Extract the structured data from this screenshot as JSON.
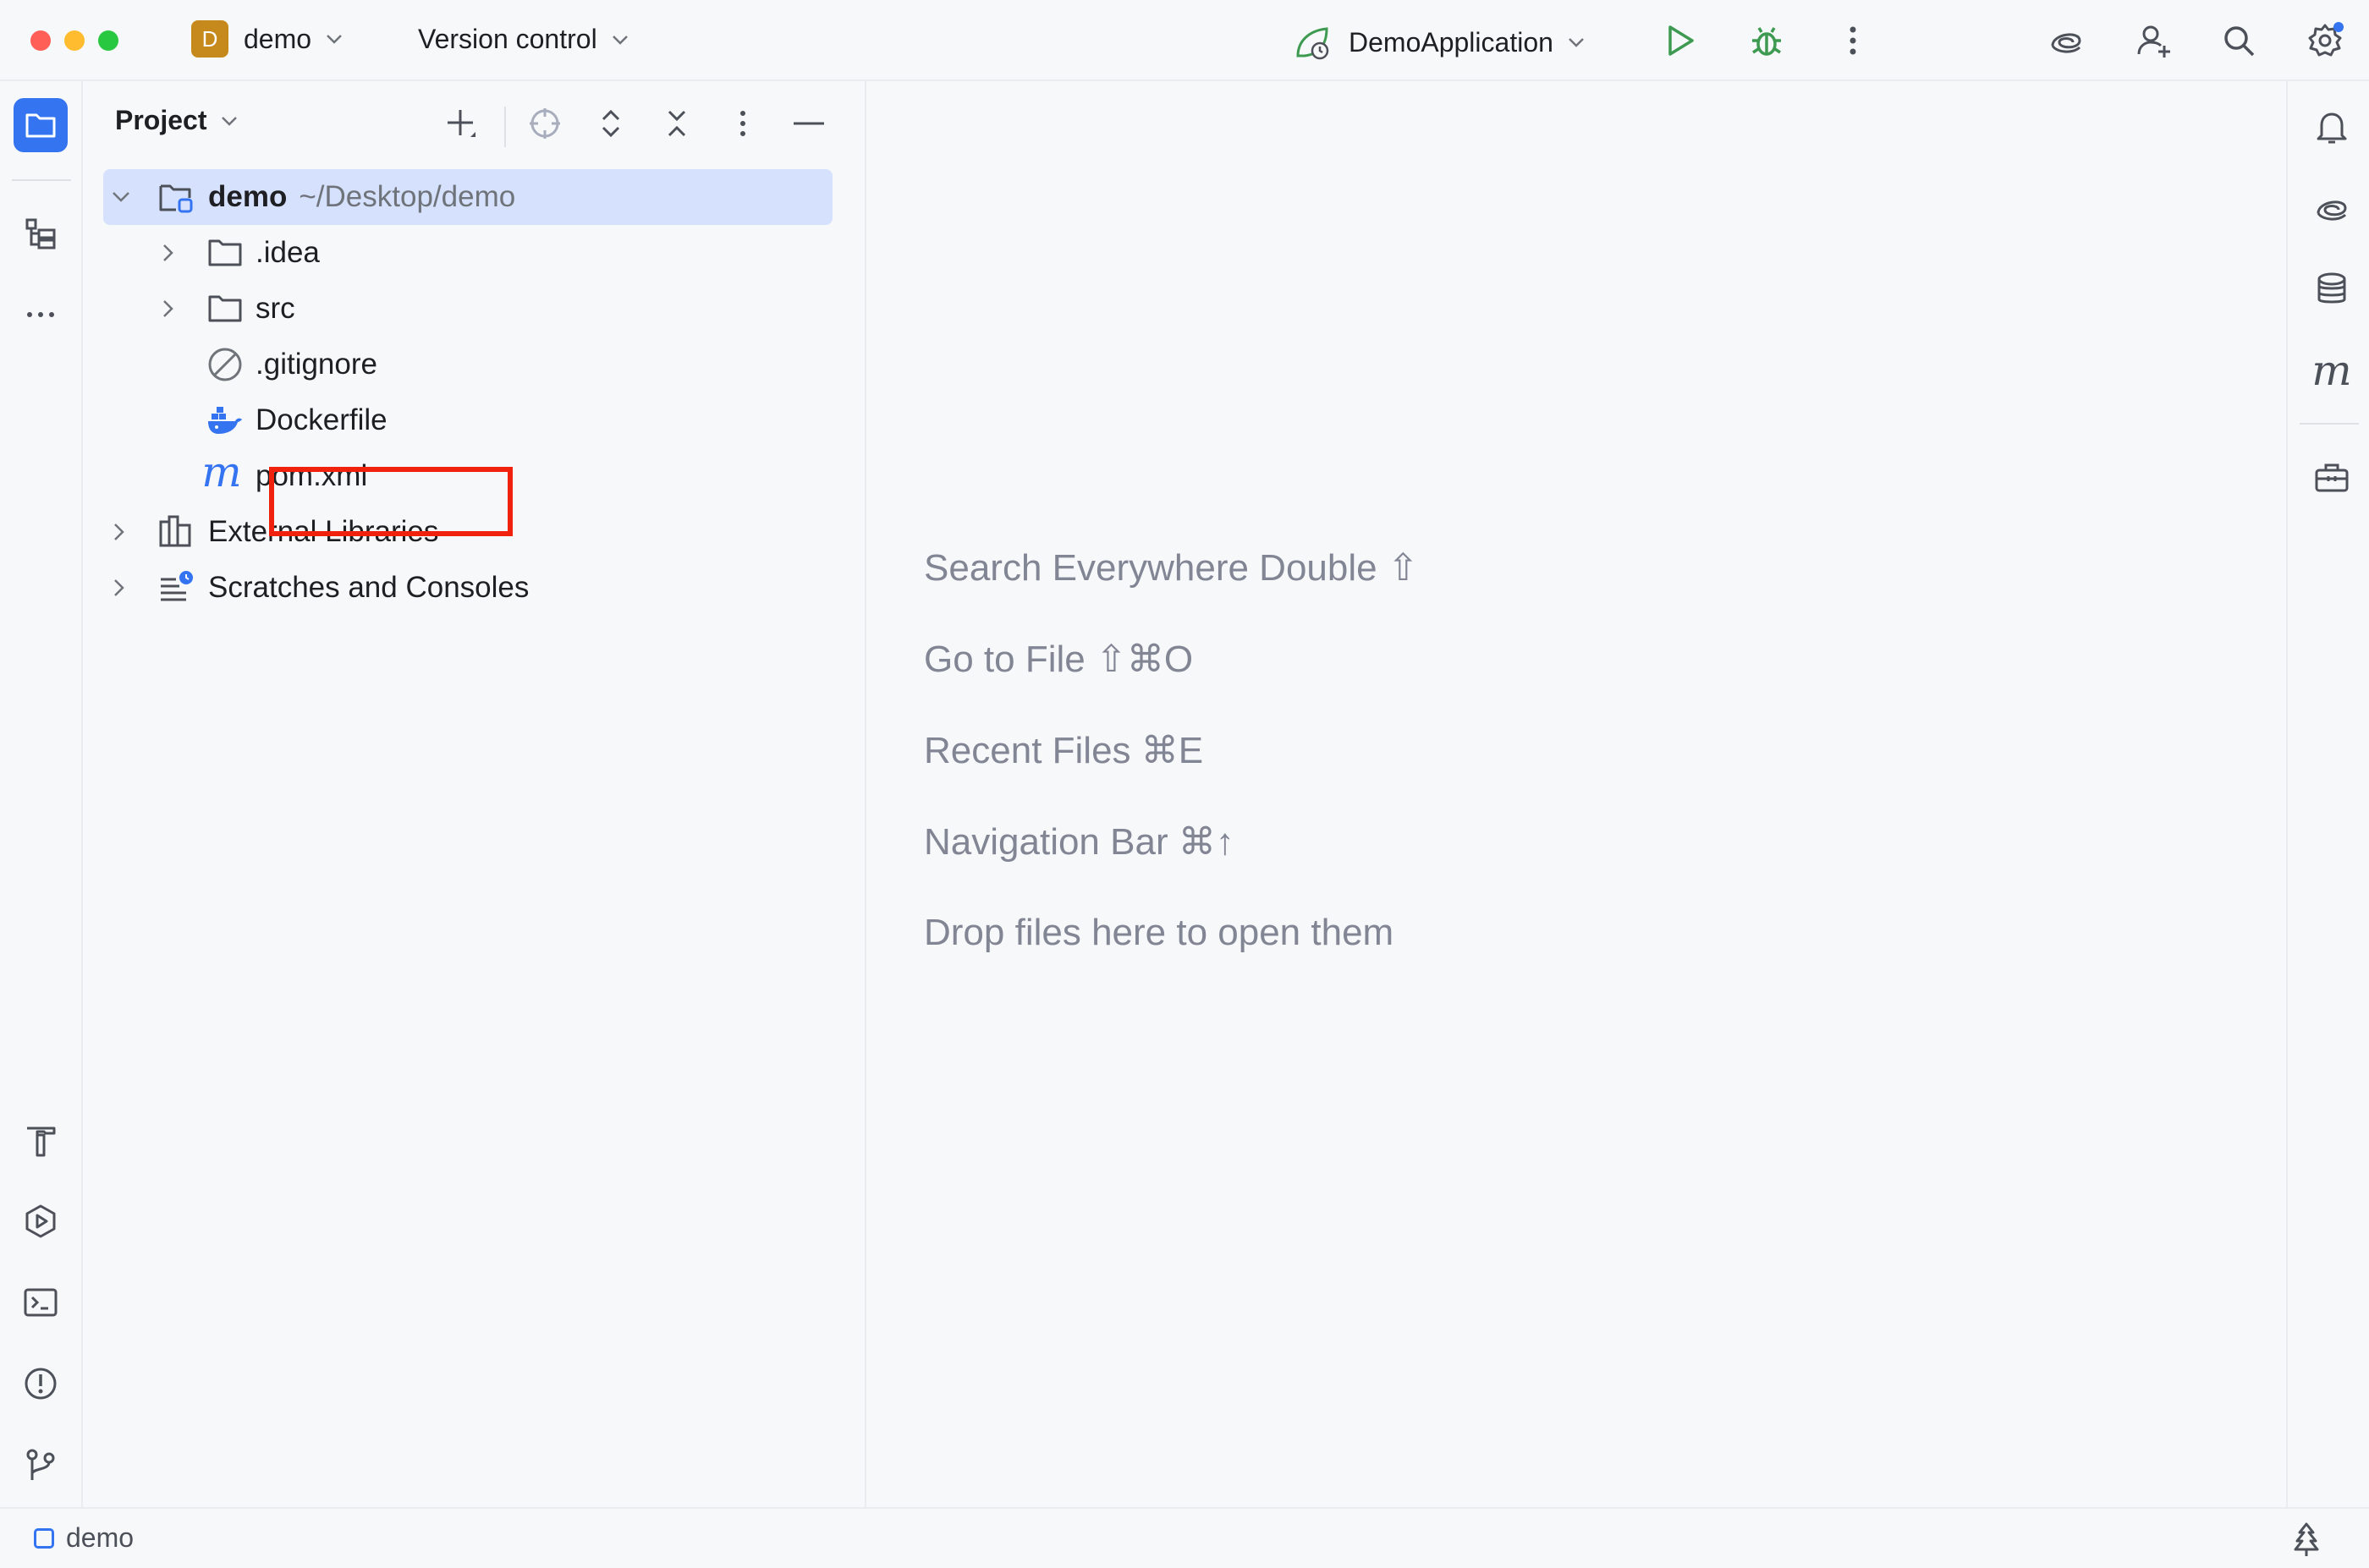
{
  "titlebar": {
    "project_badge": "D",
    "project_name": "demo",
    "vcs_label": "Version control",
    "run_config": "DemoApplication",
    "icons": [
      "run-icon",
      "debug-icon",
      "more-vertical-icon",
      "ai-assistant-icon",
      "add-user-icon",
      "search-icon",
      "settings-icon"
    ]
  },
  "left_strip": {
    "top_icons": [
      "project-folder-icon",
      "structure-icon",
      "more-horizontal-icon"
    ],
    "bottom_icons": [
      "build-hammer-icon",
      "services-icon",
      "terminal-icon",
      "problems-icon",
      "git-branch-icon"
    ]
  },
  "project_panel": {
    "title": "Project",
    "tree": [
      {
        "label": "demo",
        "path": "~/Desktop/demo",
        "icon": "module-folder-icon",
        "level": 0,
        "expanded": true,
        "selected": true
      },
      {
        "label": ".idea",
        "icon": "folder-icon",
        "level": 1,
        "expanded": false
      },
      {
        "label": "src",
        "icon": "folder-icon",
        "level": 1,
        "expanded": false
      },
      {
        "label": ".gitignore",
        "icon": "ignore-file-icon",
        "level": 1
      },
      {
        "label": "Dockerfile",
        "icon": "docker-icon",
        "level": 1,
        "highlighted": true
      },
      {
        "label": "pom.xml",
        "icon": "maven-icon",
        "level": 1
      },
      {
        "label": "External Libraries",
        "icon": "libraries-icon",
        "level": 0,
        "expanded": false
      },
      {
        "label": "Scratches and Consoles",
        "icon": "scratches-icon",
        "level": 0,
        "expanded": false
      }
    ]
  },
  "editor": {
    "hints": [
      "Search Everywhere Double ⇧",
      "Go to File ⇧⌘O",
      "Recent Files ⌘E",
      "Navigation Bar ⌘↑",
      "Drop files here to open them"
    ]
  },
  "right_strip": {
    "icons": [
      "notifications-icon",
      "ai-assistant-icon",
      "database-icon",
      "maven-icon",
      "toolbox-icon"
    ],
    "maven_glyph": "m"
  },
  "statusbar": {
    "breadcrumb": "demo"
  },
  "colors": {
    "accent": "#3574f0",
    "run_green": "#3d9a50",
    "highlight_red": "#f0220e",
    "badge_orange": "#c5891c",
    "selection": "#d5e1fd"
  }
}
